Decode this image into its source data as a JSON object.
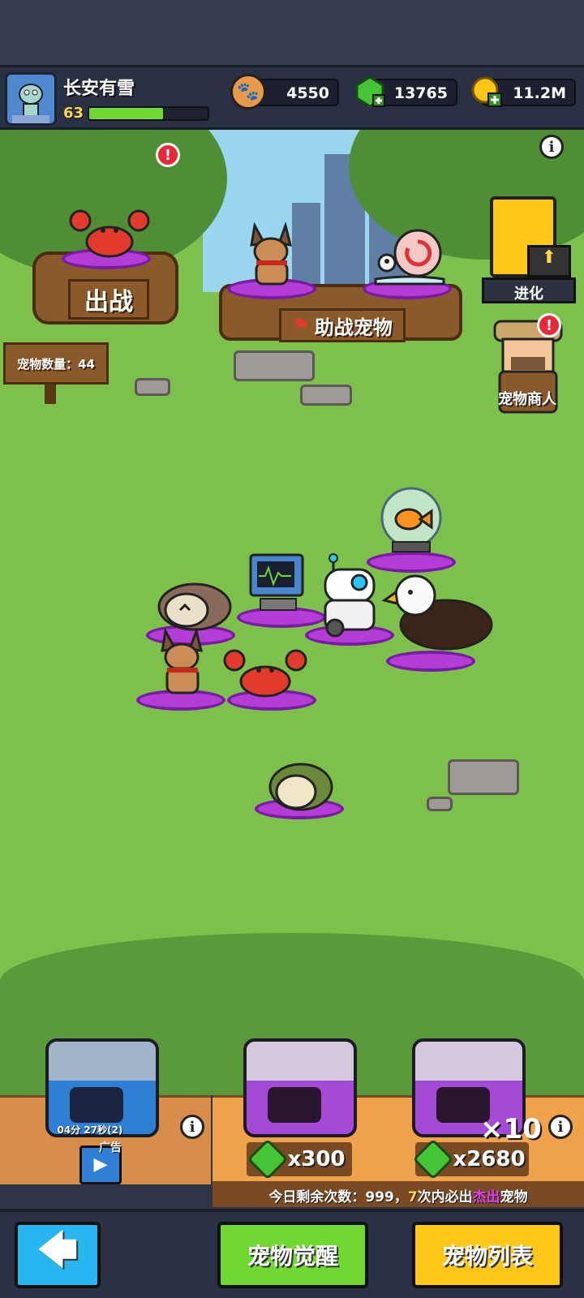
{
  "player": {
    "name": "长安有雪",
    "level": "63",
    "xp_fraction": 0.62
  },
  "currencies": {
    "paws": "4550",
    "gems": "13765",
    "gold": "11.2M"
  },
  "scene": {
    "battle_label": "出战",
    "assist_label": "助战宠物",
    "pet_count_label": "宠物数量：44",
    "evolve_label": "进化",
    "merchant_label": "宠物商人",
    "alert_glyph": "!",
    "info_glyph": "i"
  },
  "shop": {
    "ad_chest": {
      "timer": "04分 27秒(2)",
      "ad_label": "广告"
    },
    "single_chest": {
      "cost": "x300"
    },
    "ten_chest": {
      "multiplier": "×10",
      "cost": "x2680"
    },
    "daily_notice": {
      "prefix": "今日剩余次数：999，",
      "count": "7",
      "middle": "次内必出",
      "highlight": "杰出",
      "suffix": "宠物"
    }
  },
  "bottom": {
    "back_arrow": "🡄",
    "awaken_label": "宠物觉醒",
    "list_label": "宠物列表"
  },
  "colors": {
    "ring": "#b43dd8",
    "awaken_btn": "#6fd832",
    "list_btn": "#ffc61a",
    "back_btn": "#27b6f0",
    "highlight": "#e23cff",
    "count": "#ffd94a"
  }
}
